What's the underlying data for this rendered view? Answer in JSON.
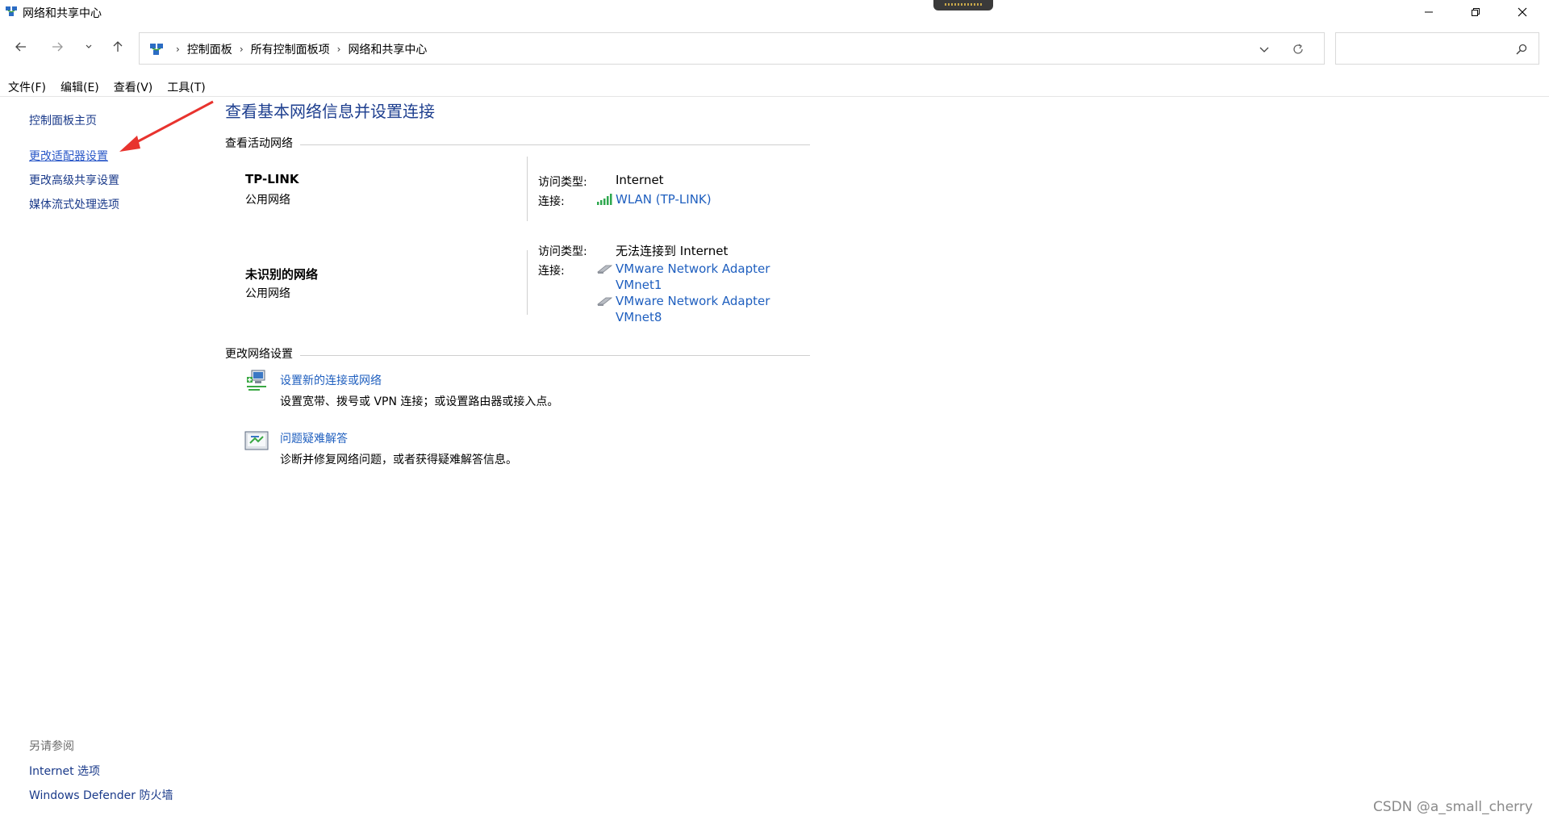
{
  "window": {
    "title": "网络和共享中心"
  },
  "nav": {
    "breadcrumbs": [
      "控制面板",
      "所有控制面板项",
      "网络和共享中心"
    ],
    "search_placeholder": ""
  },
  "menu": [
    "文件(F)",
    "编辑(E)",
    "查看(V)",
    "工具(T)"
  ],
  "left_pane": {
    "home": "控制面板主页",
    "change_adapter": "更改适配器设置",
    "change_advanced": "更改高级共享设置",
    "media_streaming": "媒体流式处理选项",
    "see_also_title": "另请参阅",
    "internet_options": "Internet 选项",
    "defender_firewall": "Windows Defender 防火墙"
  },
  "main": {
    "heading": "查看基本网络信息并设置连接",
    "active_networks_title": "查看活动网络",
    "networks": [
      {
        "name": "TP-LINK",
        "category": "公用网络",
        "access_label": "访问类型:",
        "access_value": "Internet",
        "conn_label": "连接:",
        "connections": [
          "WLAN (TP-LINK)"
        ]
      },
      {
        "name": "未识别的网络",
        "category": "公用网络",
        "access_label": "访问类型:",
        "access_value": "无法连接到 Internet",
        "conn_label": "连接:",
        "connections": [
          "VMware Network Adapter",
          "VMnet1",
          "VMware Network Adapter",
          "VMnet8"
        ]
      }
    ],
    "change_settings_title": "更改网络设置",
    "tasks": [
      {
        "link": "设置新的连接或网络",
        "description": "设置宽带、拨号或 VPN 连接；或设置路由器或接入点。"
      },
      {
        "link": "问题疑难解答",
        "description": "诊断并修复网络问题，或者获得疑难解答信息。"
      }
    ]
  },
  "watermark": "CSDN @a_small_cherry",
  "colors": {
    "link": "#1f5fbf",
    "heading": "#1e3f8f",
    "annotation_arrow": "#e8332e"
  }
}
